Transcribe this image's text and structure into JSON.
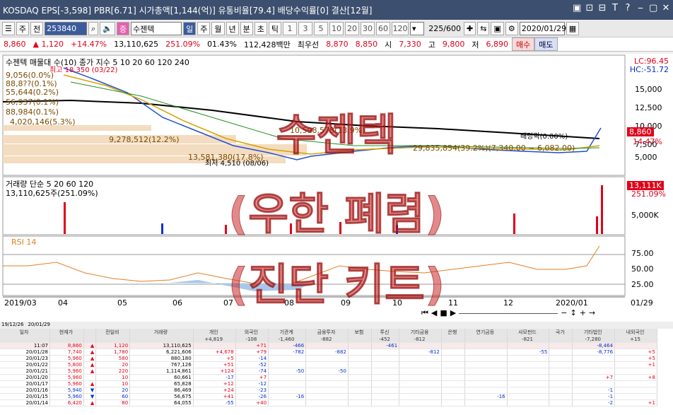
{
  "titlebar": {
    "text": "KOSDAQ EPS[-3,598] PBR[6.71] 시가총액[1,144(억)] 유통비율[79.4] 배당수익률[0] 결산[12월]",
    "controls": [
      "▣",
      "⊡",
      "⊟",
      "T",
      "?",
      "⎯",
      "▢",
      "✕"
    ]
  },
  "toolbar": {
    "period_select": "주",
    "prev_label": "전",
    "code_value": "253840",
    "search_icon": "search-icon",
    "speaker_icon": "speaker-icon",
    "tag": "증",
    "stock_name": "수젠텍",
    "periods": [
      "일",
      "주",
      "월",
      "년",
      "분",
      "초",
      "틱"
    ],
    "selected_period": "일",
    "minutes": [
      "1",
      "3",
      "5",
      "10",
      "20",
      "30",
      "60",
      "120"
    ],
    "count": "225",
    "total": "/600",
    "date": "2020/01/29"
  },
  "quote": {
    "price": "8,860",
    "change": "▲ 1,120",
    "change_pct": "+14.47%",
    "volume": "13,110,625",
    "volume_ratio": "251.09%",
    "turnover": "01.43%",
    "amount": "112,428백만",
    "priority_label": "최우선",
    "ask": "8,870",
    "bid": "8,850",
    "open_label": "시",
    "open": "7,330",
    "high_label": "고",
    "high": "9,800",
    "low_label": "저",
    "low": "6,890",
    "buy": "매수",
    "sell": "매도"
  },
  "chart": {
    "price_legend": "수젠텍 매물대 수(10)  종가 지수 5  10  20  60  120  240",
    "lc": "LC:96.45",
    "hc": "HC:-51.72",
    "y_ticks": [
      "15,000",
      "12,500",
      "10,000",
      "7,500",
      "5,000"
    ],
    "current_price": "8,860",
    "current_pct": "14.47%",
    "vol_legend": "거래량  단순 5  20  60  120",
    "vol_value": "13,110,625주(251.09%)",
    "vol_tag": "13,111K",
    "vol_pct": "251.09%",
    "vol_tick": "5,000K",
    "rsi_legend": "RSI 14",
    "rsi_ticks": [
      "75.00",
      "50.00",
      "25.00"
    ],
    "x_labels": [
      "2019/03",
      "04",
      "05",
      "06",
      "07",
      "08",
      "09",
      "10",
      "11",
      "12",
      "2020/01",
      "01/29"
    ],
    "annotations": {
      "high": "최고 18,350 (03/22)",
      "low": "최저 4,510 (08/06)",
      "dividend": "배당락(0.00%)",
      "vp1": "4,020,146(5.3%)",
      "vp2": "9,278,512(12.2%)",
      "vp3": "13,581,380(17.8%)",
      "vp4": "10,598,578(13.9%)",
      "vp5": "29,835,854(39.2%)(7,340.00 ~ 6,082.00)",
      "vp6": "88,984(0.1%)",
      "vp7": "56,937(0.1%)",
      "vp8": "55,644(0.2%)",
      "vp9": "88,8??(0.1%)",
      "vp10": "9,056(0.0%)"
    }
  },
  "watermark": {
    "line1": "수젠텍",
    "line2": "(우한 폐렴)",
    "line3": "(진단 키트)"
  },
  "grid": {
    "from": "19/12/26",
    "to": "20/01/29",
    "headers": [
      "일자",
      "현재가",
      "",
      "전일비",
      "거래량",
      "개인",
      "외국인",
      "기관계",
      "금융투자",
      "보험",
      "투신",
      "기타금융",
      "은행",
      "연기금등",
      "사모펀드",
      "국가",
      "기타법인",
      "내외국인"
    ],
    "summary": [
      "",
      "",
      "",
      "",
      "",
      "+4,819",
      "-108",
      "-1,460",
      "-882",
      "",
      "-452",
      "-812",
      "",
      "",
      "-821",
      "",
      "-7,280",
      "+15"
    ],
    "rows": [
      [
        "11:07",
        "8,860",
        "▲",
        "1,120",
        "13,110,625",
        "",
        "+71",
        "-466",
        "",
        "",
        "-461",
        "",
        "",
        "",
        "",
        "",
        "-8,464",
        ""
      ],
      [
        "20/01/28",
        "7,740",
        "▲",
        "1,780",
        "6,221,606",
        "+4,678",
        "+79",
        "-782",
        "-882",
        "",
        "",
        "-812",
        "",
        "",
        "-55",
        "",
        "-8,776",
        "+5"
      ],
      [
        "20/01/23",
        "5,960",
        "▲",
        "580",
        "880,180",
        "+5",
        "-14",
        "",
        "",
        "",
        "",
        "",
        "",
        "",
        "",
        "",
        "",
        "+5"
      ],
      [
        "20/01/22",
        "5,800",
        "▲",
        "20",
        "767,126",
        "+51",
        "-52",
        "",
        "",
        "",
        "",
        "",
        "",
        "",
        "",
        "",
        "",
        "+1"
      ],
      [
        "20/01/21",
        "5,960",
        "▲",
        "220",
        "1,114,861",
        "+124",
        "-74",
        "-50",
        "-50",
        "",
        "",
        "",
        "",
        "",
        "",
        "",
        "",
        ""
      ],
      [
        "20/01/20",
        "5,960",
        "",
        "10",
        "60,661",
        "-17",
        "+7",
        "",
        "",
        "",
        "",
        "",
        "",
        "",
        "",
        "",
        "+7",
        "+8"
      ],
      [
        "20/01/17",
        "5,960",
        "▲",
        "10",
        "65,828",
        "+12",
        "-12",
        "",
        "",
        "",
        "",
        "",
        "",
        "",
        "",
        "",
        "",
        ""
      ],
      [
        "20/01/16",
        "5,940",
        "▼",
        "20",
        "86,469",
        "+24",
        "-23",
        "",
        "",
        "",
        "",
        "",
        "",
        "",
        "",
        "",
        "-1",
        ""
      ],
      [
        "20/01/15",
        "5,960",
        "▼",
        "60",
        "56,675",
        "+41",
        "-26",
        "-16",
        "",
        "",
        "",
        "",
        "",
        "-16",
        "",
        "",
        "-1",
        ""
      ],
      [
        "20/01/14",
        "6,420",
        "▲",
        "80",
        "64,055",
        "-55",
        "+40",
        "",
        "",
        "",
        "",
        "",
        "",
        "",
        "",
        "",
        "-2",
        "+1"
      ]
    ]
  },
  "colors": {
    "up": "#e0001a",
    "down": "#1030d0",
    "ma5": "#c050c0",
    "ma10": "#2050d0",
    "ma20": "#d8a000",
    "ma60": "#209020",
    "ma240": "#000000"
  }
}
